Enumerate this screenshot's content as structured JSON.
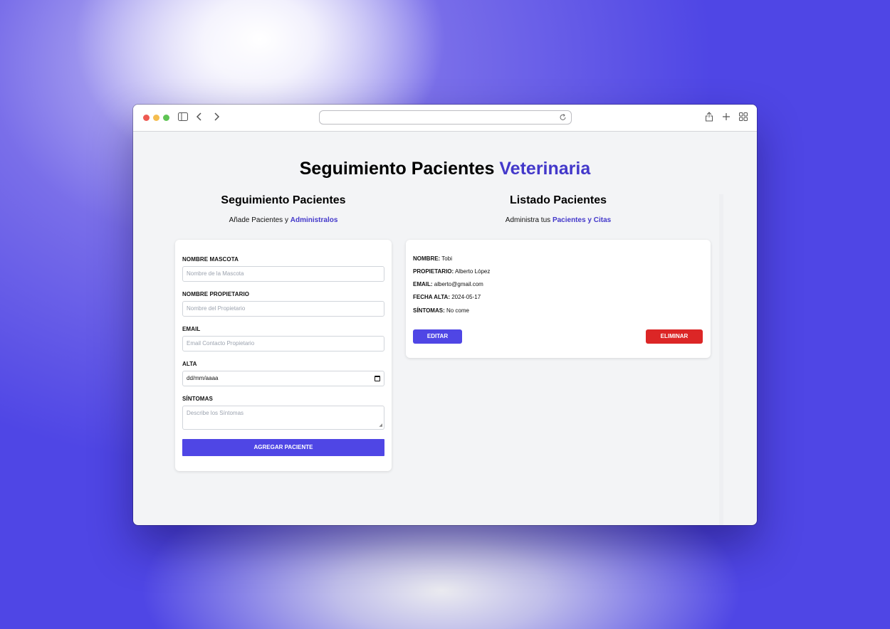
{
  "app": {
    "title": "Seguimiento Pacientes",
    "title_accent": "Veterinaria"
  },
  "form_section": {
    "heading": "Seguimiento Pacientes",
    "sub_text": "Añade Pacientes y",
    "sub_accent": "Administralos",
    "fields": {
      "pet_name": {
        "label": "NOMBRE MASCOTA",
        "placeholder": "Nombre de la Mascota"
      },
      "owner_name": {
        "label": "NOMBRE PROPIETARIO",
        "placeholder": "Nombre del Propietario"
      },
      "email": {
        "label": "EMAIL",
        "placeholder": "Email Contacto Propietario"
      },
      "alta": {
        "label": "ALTA",
        "value": "dd/mm/aaaa"
      },
      "symptoms": {
        "label": "SÍNTOMAS",
        "placeholder": "Describe los Síntomas"
      }
    },
    "submit_label": "AGREGAR PACIENTE"
  },
  "list_section": {
    "heading": "Listado Pacientes",
    "sub_text": "Administra tus",
    "sub_accent": "Pacientes y Citas",
    "patient": {
      "name_label": "NOMBRE:",
      "name": "Tobi",
      "owner_label": "PROPIETARIO:",
      "owner": "Alberto López",
      "email_label": "EMAIL:",
      "email": "alberto@gmail.com",
      "date_label": "FECHA ALTA:",
      "date": "2024-05-17",
      "symptoms_label": "SÍNTOMAS:",
      "symptoms": "No come"
    },
    "edit_label": "EDITAR",
    "delete_label": "ELIMINAR"
  },
  "colors": {
    "accent": "#4338ca",
    "primary_button": "#4f46e5",
    "danger_button": "#dc2626"
  }
}
